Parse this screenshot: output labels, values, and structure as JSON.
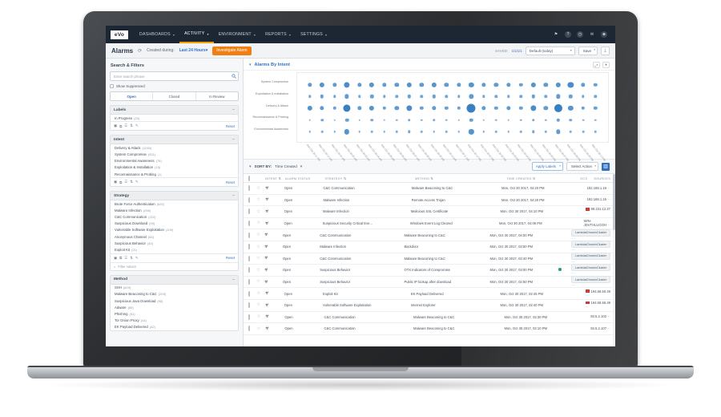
{
  "app": {
    "logo": "eVo",
    "nav": [
      {
        "label": "DASHBOARDS",
        "caret": "▾",
        "active": false
      },
      {
        "label": "ACTIVITY",
        "caret": "▾",
        "active": true
      },
      {
        "label": "ENVIRONMENT",
        "caret": "▾",
        "active": false
      },
      {
        "label": "REPORTS",
        "caret": "▾",
        "active": false
      },
      {
        "label": "SETTINGS",
        "caret": "▾",
        "active": false
      }
    ],
    "right_icons": [
      {
        "name": "pin-icon",
        "glyph": "⚑"
      },
      {
        "name": "help-icon",
        "glyph": "?"
      },
      {
        "name": "notifications-icon",
        "glyph": "◷"
      },
      {
        "name": "mail-icon",
        "glyph": "✉"
      },
      {
        "name": "user-icon",
        "glyph": "☻"
      }
    ]
  },
  "subbar": {
    "title": "Alarms",
    "refresh_icon": "⟳",
    "created_during_label": "Created during:",
    "created_during_value": "Last 24 Hours",
    "created_during_caret": "▾",
    "investigate_button": "Investigate Alarm",
    "saved_label": "SAVED:",
    "saved_count": "1/1/1/1",
    "saved_select": "Default (today)",
    "save_button": "Save",
    "export_icon": "⤓"
  },
  "sidebar": {
    "title": "Search & Filters",
    "search_placeholder": "Enter search phrase",
    "search_icon": "🔍",
    "show_suppressed": "Show Suppressed",
    "status_tabs": [
      {
        "label": "Open",
        "active": true
      },
      {
        "label": "Closed",
        "active": false
      },
      {
        "label": "In Review",
        "active": false
      }
    ],
    "panels": [
      {
        "title": "Labels",
        "items": [
          {
            "label": "In Progress",
            "count": "(23)"
          }
        ],
        "footer_icons": [
          "▣",
          "⧉",
          "☰",
          "⇅",
          "✎"
        ],
        "reset": "Reset",
        "filter_placeholder": ""
      },
      {
        "title": "Intent",
        "items": [
          {
            "label": "Delivery & Attack",
            "count": "(1248)"
          },
          {
            "label": "System Compromise",
            "count": "(521)"
          },
          {
            "label": "Environmental Awareness",
            "count": "(75)"
          },
          {
            "label": "Exploitation & Installation",
            "count": "(15)"
          },
          {
            "label": "Reconnaissance & Probing",
            "count": "(1)"
          }
        ],
        "footer_icons": [
          "▣",
          "⧉",
          "☰",
          "⇅",
          "✎"
        ],
        "reset": "Reset",
        "filter_placeholder": ""
      },
      {
        "title": "Strategy",
        "items": [
          {
            "label": "Brute Force Authentication",
            "count": "(629)"
          },
          {
            "label": "Malware Infection",
            "count": "(298)"
          },
          {
            "label": "C&C Communication",
            "count": "(222)"
          },
          {
            "label": "Suspicious Download",
            "count": "(99)"
          },
          {
            "label": "Vulnerable Software Exploitation",
            "count": "(109)"
          },
          {
            "label": "Anonymous Channel",
            "count": "(60)"
          },
          {
            "label": "Suspicious Behavior",
            "count": "(40)"
          },
          {
            "label": "Exploit Kit",
            "count": "(21)"
          }
        ],
        "footer_icons": [
          "▣",
          "⧉",
          "☰",
          "⇅",
          "✎"
        ],
        "reset": "Reset",
        "filter_placeholder": "Filter values"
      },
      {
        "title": "Method",
        "items": [
          {
            "label": "SSH",
            "count": "(629)"
          },
          {
            "label": "Malware Beaconing to C&C",
            "count": "(209)"
          },
          {
            "label": "Suspicious Java Download",
            "count": "(95)"
          },
          {
            "label": "Adware",
            "count": "(65)"
          },
          {
            "label": "Phishing",
            "count": "(51)"
          },
          {
            "label": "Tor Onion Proxy",
            "count": "(44)"
          },
          {
            "label": "EK Payload Delivered",
            "count": "(42)"
          }
        ],
        "footer_icons": [
          "▣",
          "⧉",
          "☰",
          "⇅",
          "✎"
        ],
        "reset": "Reset",
        "filter_placeholder": ""
      }
    ]
  },
  "chart_panel": {
    "title": "Alarms By Intent",
    "collapse_icon": "▾",
    "expand_icon": "⤢",
    "menu_icon": "▾"
  },
  "chart_data": {
    "type": "scatter",
    "title": "Alarms By Intent",
    "xlabel": "",
    "ylabel": "",
    "categories_y": [
      "System Compromise",
      "Exploitation & Installation",
      "Delivery & Attack",
      "Reconnaissance & Probing",
      "Environmental Awareness"
    ],
    "categories_x": [
      "Mon Oct 30 11 PM",
      "Mon Oct 30 12 AM",
      "Mon Oct 30 01 AM",
      "Mon Oct 30 02 AM",
      "Mon Oct 30 03 AM",
      "Mon Oct 30 04 AM",
      "Mon Oct 30 05 AM",
      "Mon Oct 30 06 AM",
      "Mon Oct 30 07 AM",
      "Mon Oct 30 08 AM",
      "Mon Oct 30 09 AM",
      "Mon Oct 30 10 AM",
      "Mon Oct 30 11 AM",
      "Mon Oct 30 12 PM",
      "Mon Oct 30 01 PM",
      "Mon Oct 30 02 PM",
      "Mon Oct 30 03 PM",
      "Mon Oct 30 04 PM",
      "Mon Oct 30 05 PM",
      "Mon Oct 30 06 PM",
      "Mon Oct 30 07 PM",
      "Mon Oct 30 08 PM",
      "Mon Oct 30 09 PM",
      "Mon Oct 30 10 PM"
    ],
    "series": [
      {
        "name": "System Compromise",
        "values": [
          4,
          5,
          4,
          6,
          4,
          5,
          4,
          4,
          5,
          4,
          5,
          4,
          4,
          5,
          4,
          4,
          4,
          3,
          5,
          4,
          5,
          6,
          4,
          3
        ]
      },
      {
        "name": "Exploitation & Installation",
        "values": [
          2,
          3,
          2,
          4,
          2,
          3,
          2,
          2,
          3,
          2,
          3,
          2,
          2,
          4,
          2,
          2,
          2,
          2,
          3,
          2,
          4,
          3,
          2,
          2
        ]
      },
      {
        "name": "Delivery & Attack",
        "values": [
          5,
          4,
          3,
          8,
          4,
          5,
          3,
          4,
          6,
          3,
          4,
          3,
          3,
          10,
          4,
          3,
          4,
          3,
          6,
          4,
          9,
          5,
          3,
          3
        ]
      },
      {
        "name": "Reconnaissance & Probing",
        "values": [
          1,
          2,
          1,
          3,
          1,
          2,
          1,
          1,
          2,
          1,
          2,
          1,
          1,
          3,
          1,
          1,
          1,
          1,
          2,
          1,
          3,
          2,
          1,
          1
        ]
      },
      {
        "name": "Environmental Awareness",
        "values": [
          1,
          1,
          1,
          5,
          1,
          1,
          1,
          1,
          2,
          1,
          1,
          1,
          1,
          5,
          1,
          1,
          1,
          1,
          2,
          1,
          4,
          1,
          1,
          1
        ]
      }
    ],
    "color": "#2c79bf",
    "grid": false,
    "legend": "none"
  },
  "table_toolbar": {
    "sort_label": "SORT BY:",
    "sort_value": "Time Created",
    "sort_caret": "▾",
    "apply_labels": "Apply Labels",
    "select_action": "Select Action",
    "grid_icon": "▥"
  },
  "table": {
    "columns": [
      "",
      "",
      "INTENT",
      "ALARM STATUS",
      "STRATEGY",
      "METHOD",
      "TIME CREATED",
      "OCS",
      "SOURCES"
    ],
    "sortable_flags": [
      false,
      false,
      true,
      false,
      true,
      true,
      true,
      false,
      false
    ],
    "rows": [
      {
        "status": "Open",
        "strategy": "C&C Communication",
        "method": "Malware Beaconing to C&C",
        "time": "Mon, Oct 30 2017, 04:20 PM",
        "source": "192.168.1.16",
        "source_type": "plain",
        "sev": ""
      },
      {
        "status": "Open",
        "strategy": "Malware Infection",
        "method": "Remote Access Trojan",
        "time": "Mon, Oct 30 2017, 04:20 PM",
        "source": "192.168.1.16",
        "source_type": "plain",
        "sev": ""
      },
      {
        "status": "Open",
        "strategy": "Malware Infection",
        "method": "Malicious SSL Certificate",
        "time": "Mon, Oct 30 2017, 04:10 PM",
        "source": "89.231.12.27",
        "source_type": "flag",
        "sev": "",
        "flag_color": "#d94141"
      },
      {
        "status": "Open",
        "strategy": "Suspicious Security Critical Eve...",
        "method": "Windows Event Log Cleared",
        "time": "Mon, Oct 30 2017, 04:06 PM",
        "source": "WIN-JDVTHLUGOH",
        "source_type": "plain",
        "sev": ""
      },
      {
        "status": "Open",
        "strategy": "C&C Communication",
        "method": "Malware Beaconing to C&C",
        "time": "Mon, Oct 30 2017, 04:00 PM",
        "source": "LambdaChronixCluster",
        "source_type": "chip",
        "sev": ""
      },
      {
        "status": "Open",
        "strategy": "Malware Infection",
        "method": "Backdoor",
        "time": "Mon, Oct 30 2017, 03:50 PM",
        "source": "LambdaChronixCluster",
        "source_type": "chip",
        "sev": ""
      },
      {
        "status": "Open",
        "strategy": "C&C Communication",
        "method": "Malware Beaconing to C&C",
        "time": "Mon, Oct 30 2017, 03:40 PM",
        "source": "LambdaChronixCluster",
        "source_type": "chip",
        "sev": ""
      },
      {
        "status": "Open",
        "strategy": "Suspicious Behavior",
        "method": "OTX Indicators of Compromise",
        "time": "Mon, Oct 30 2017, 03:00 PM",
        "source": "LambdaChronixCluster",
        "source_type": "chip",
        "sev": "#25a35a"
      },
      {
        "status": "Open",
        "strategy": "Suspicious Behavior",
        "method": "Public IP lookup after download",
        "time": "Mon, Oct 30 2017, 02:50 PM",
        "source": "LambdaChronixCluster",
        "source_type": "chip",
        "sev": ""
      },
      {
        "status": "Open",
        "strategy": "Exploit Kit",
        "method": "EK Payload Delivered",
        "time": "Mon, Oct 30 2017, 02:45 PM",
        "source": "194.58.50.49",
        "source_type": "flag",
        "sev": "",
        "flag_color": "#d94141"
      },
      {
        "status": "Open",
        "strategy": "Vulnerable Software Exploitation",
        "method": "Internet Explorer",
        "time": "Mon, Oct 30 2017, 02:40 PM",
        "source": "194.58.56.49",
        "source_type": "flag",
        "sev": "",
        "flag_color": "#d94141"
      },
      {
        "status": "Open",
        "strategy": "C&C Communication",
        "method": "Malware Beaconing to C&C",
        "time": "Mon, Oct 30 2017, 02:30 PM",
        "source": "93.5.2.102",
        "source_type": "plain",
        "sev": ""
      },
      {
        "status": "Open",
        "strategy": "C&C Communication",
        "method": "Malware Beaconing to C&C",
        "time": "Mon, Oct 30 2017, 02:10 PM",
        "source": "93.5.2.107",
        "source_type": "plain",
        "sev": ""
      }
    ],
    "row_menu_icon": "⋯",
    "star_icon": "☆",
    "intent_icon": "☣"
  }
}
